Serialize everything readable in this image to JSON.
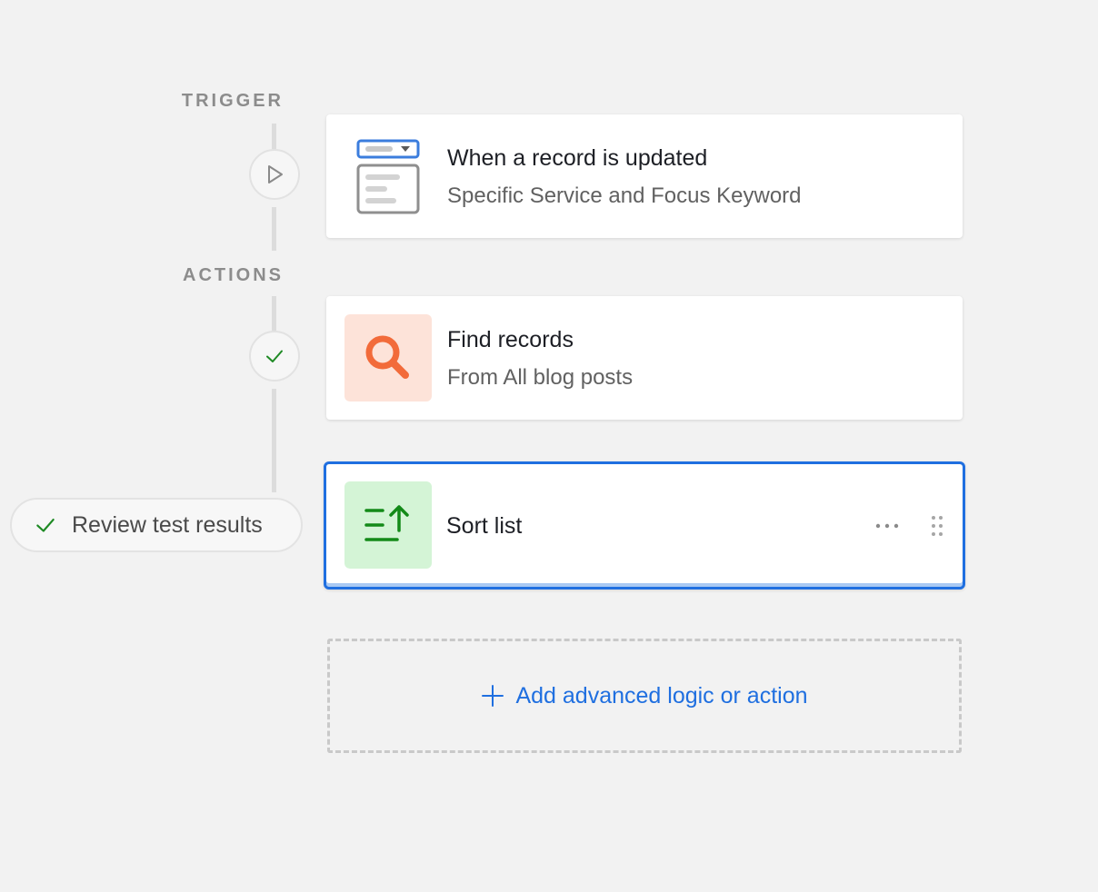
{
  "trigger": {
    "section_label": "TRIGGER",
    "card": {
      "title": "When a record is updated",
      "subtitle": "Specific Service and Focus Keyword",
      "icon": "record-form-icon",
      "node_icon": "play-icon"
    }
  },
  "actions": {
    "section_label": "ACTIONS",
    "items": [
      {
        "title": "Find records",
        "subtitle": "From All blog posts",
        "icon": "search-icon",
        "icon_bg": "#fde3d9",
        "icon_color": "#f26b3a",
        "node_icon": "check-icon"
      },
      {
        "title": "Sort list",
        "icon": "sort-list-icon",
        "icon_bg": "#d4f4d6",
        "icon_color": "#138a18",
        "selected": true,
        "menu_icon": "more-horizontal-icon",
        "drag_icon": "drag-handle-icon"
      }
    ]
  },
  "review": {
    "label": "Review test results",
    "icon": "check-icon"
  },
  "add_action": {
    "label": "Add advanced logic or action",
    "icon": "plus-icon"
  },
  "colors": {
    "accent": "#1f6fe0",
    "check": "#1e8a24",
    "background": "#f2f2f2"
  }
}
